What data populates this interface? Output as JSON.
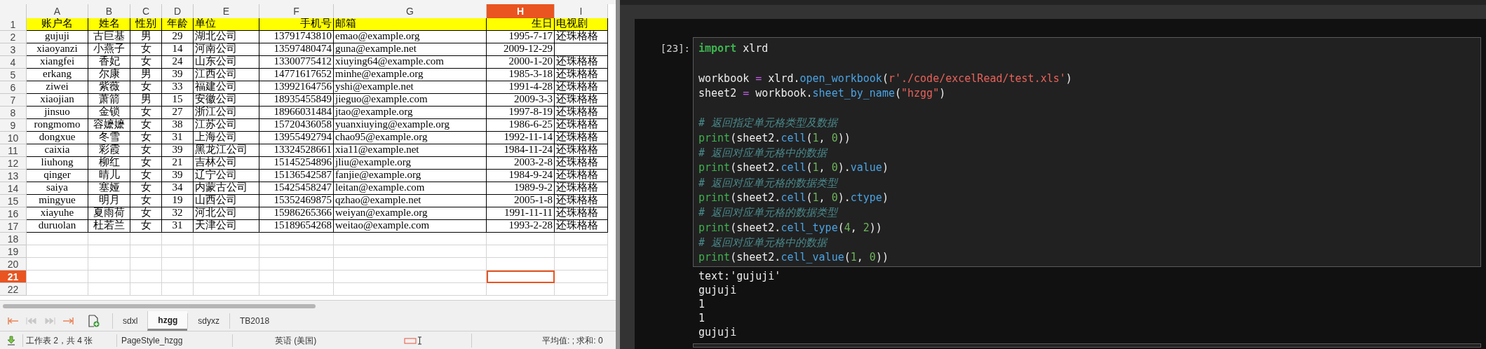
{
  "spreadsheet": {
    "column_headers": [
      {
        "label": "A",
        "selected": false
      },
      {
        "label": "B",
        "selected": false
      },
      {
        "label": "C",
        "selected": false
      },
      {
        "label": "D",
        "selected": false
      },
      {
        "label": "E",
        "selected": false
      },
      {
        "label": "F",
        "selected": false
      },
      {
        "label": "G",
        "selected": false
      },
      {
        "label": "H",
        "selected": true
      },
      {
        "label": "I",
        "selected": false
      }
    ],
    "rows": [
      {
        "number": "1",
        "selected": false,
        "cells": [
          "账户名",
          "姓名",
          "性别",
          "年龄",
          "单位",
          "手机号",
          "邮箱",
          "生日",
          "电视剧"
        ]
      },
      {
        "number": "2",
        "selected": false,
        "cells": [
          "gujuji",
          "古巨基",
          "男",
          "29",
          "湖北公司",
          "13791743810",
          "emao@example.org",
          "1995-7-17",
          "还珠格格"
        ]
      },
      {
        "number": "3",
        "selected": false,
        "cells": [
          "xiaoyanzi",
          "小燕子",
          "女",
          "14",
          "河南公司",
          "13597480474",
          "guna@example.net",
          "2009-12-29",
          null
        ]
      },
      {
        "number": "4",
        "selected": false,
        "cells": [
          "xiangfei",
          "香妃",
          "女",
          "24",
          "山东公司",
          "13300775412",
          "xiuying64@example.com",
          "2000-1-20",
          "还珠格格"
        ]
      },
      {
        "number": "5",
        "selected": false,
        "cells": [
          "erkang",
          "尔康",
          "男",
          "39",
          "江西公司",
          "14771617652",
          "minhe@example.org",
          "1985-3-18",
          "还珠格格"
        ]
      },
      {
        "number": "6",
        "selected": false,
        "cells": [
          "ziwei",
          "紫薇",
          "女",
          "33",
          "福建公司",
          "13992164756",
          "yshi@example.net",
          "1991-4-28",
          "还珠格格"
        ]
      },
      {
        "number": "7",
        "selected": false,
        "cells": [
          "xiaojian",
          "萧箭",
          "男",
          "15",
          "安徽公司",
          "18935455849",
          "jieguo@example.com",
          "2009-3-3",
          "还珠格格"
        ]
      },
      {
        "number": "8",
        "selected": false,
        "cells": [
          "jinsuo",
          "金锁",
          "女",
          "27",
          "浙江公司",
          "18966031484",
          "jtao@example.org",
          "1997-8-19",
          "还珠格格"
        ]
      },
      {
        "number": "9",
        "selected": false,
        "cells": [
          "rongmomo",
          "容嬷嬷",
          "女",
          "38",
          "江苏公司",
          "15720436058",
          "yuanxiuying@example.org",
          "1986-6-25",
          "还珠格格"
        ]
      },
      {
        "number": "10",
        "selected": false,
        "cells": [
          "dongxue",
          "冬雪",
          "女",
          "31",
          "上海公司",
          "13955492794",
          "chao95@example.org",
          "1992-11-14",
          "还珠格格"
        ]
      },
      {
        "number": "11",
        "selected": false,
        "cells": [
          "caixia",
          "彩霞",
          "女",
          "39",
          "黑龙江公司",
          "13324528661",
          "xia11@example.net",
          "1984-11-24",
          "还珠格格"
        ]
      },
      {
        "number": "12",
        "selected": false,
        "cells": [
          "liuhong",
          "柳红",
          "女",
          "21",
          "吉林公司",
          "15145254896",
          "jliu@example.org",
          "2003-2-8",
          "还珠格格"
        ]
      },
      {
        "number": "13",
        "selected": false,
        "cells": [
          "qinger",
          "晴儿",
          "女",
          "39",
          "辽宁公司",
          "15136542587",
          "fanjie@example.org",
          "1984-9-24",
          "还珠格格"
        ]
      },
      {
        "number": "14",
        "selected": false,
        "cells": [
          "saiya",
          "塞娅",
          "女",
          "34",
          "内蒙古公司",
          "15425458247",
          "leitan@example.com",
          "1989-9-2",
          "还珠格格"
        ]
      },
      {
        "number": "15",
        "selected": false,
        "cells": [
          "mingyue",
          "明月",
          "女",
          "19",
          "山西公司",
          "15352469875",
          "qzhao@example.net",
          "2005-1-8",
          "还珠格格"
        ]
      },
      {
        "number": "16",
        "selected": false,
        "cells": [
          "xiayuhe",
          "夏雨荷",
          "女",
          "32",
          "河北公司",
          "15986265366",
          "weiyan@example.org",
          "1991-11-11",
          "还珠格格"
        ]
      },
      {
        "number": "17",
        "selected": false,
        "cells": [
          "duruolan",
          "杜若兰",
          "女",
          "31",
          "天津公司",
          "15189654268",
          "weitao@example.com",
          "1993-2-28",
          "还珠格格"
        ]
      },
      {
        "number": "18",
        "selected": false,
        "cells": []
      },
      {
        "number": "19",
        "selected": false,
        "cells": []
      },
      {
        "number": "20",
        "selected": false,
        "cells": []
      },
      {
        "number": "21",
        "selected": true,
        "cells": []
      },
      {
        "number": "22",
        "selected": false,
        "cells": []
      }
    ],
    "sheet_tabs": [
      {
        "label": "sdxl",
        "selected": false
      },
      {
        "label": "hzgg",
        "selected": true
      },
      {
        "label": "sdyxz",
        "selected": false
      },
      {
        "label": "TB2018",
        "selected": false
      }
    ],
    "status_bar": {
      "sheet_info": "工作表 2，共 4 张",
      "page_style": "PageStyle_hzgg",
      "language": "英语 (美国)",
      "summary": "平均值: ; 求和: 0"
    }
  },
  "notebook": {
    "prompt": "[23]:",
    "code_lines": [
      {
        "blank_before": false,
        "tokens": [
          {
            "kind": "keyword",
            "text": "import"
          },
          {
            "kind": "name",
            "text": " xlrd"
          }
        ]
      },
      {
        "blank_before": true,
        "tokens": [
          {
            "kind": "name",
            "text": "workbook "
          },
          {
            "kind": "operator",
            "text": "="
          },
          {
            "kind": "name",
            "text": " xlrd."
          },
          {
            "kind": "attribute",
            "text": "open_workbook"
          },
          {
            "kind": "name",
            "text": "("
          },
          {
            "kind": "string",
            "text": "r'./code/excelRead/test.xls'"
          },
          {
            "kind": "name",
            "text": ")"
          }
        ]
      },
      {
        "blank_before": false,
        "tokens": [
          {
            "kind": "name",
            "text": "sheet2 "
          },
          {
            "kind": "operator",
            "text": "="
          },
          {
            "kind": "name",
            "text": " workbook."
          },
          {
            "kind": "attribute",
            "text": "sheet_by_name"
          },
          {
            "kind": "name",
            "text": "("
          },
          {
            "kind": "string",
            "text": "\"hzgg\""
          },
          {
            "kind": "name",
            "text": ")"
          }
        ]
      },
      {
        "blank_before": true,
        "tokens": [
          {
            "kind": "comment",
            "text": "# 返回指定单元格类型及数据"
          }
        ]
      },
      {
        "blank_before": false,
        "tokens": [
          {
            "kind": "builtin",
            "text": "print"
          },
          {
            "kind": "name",
            "text": "(sheet2."
          },
          {
            "kind": "attribute",
            "text": "cell"
          },
          {
            "kind": "name",
            "text": "("
          },
          {
            "kind": "number",
            "text": "1"
          },
          {
            "kind": "name",
            "text": ", "
          },
          {
            "kind": "number",
            "text": "0"
          },
          {
            "kind": "name",
            "text": "))"
          }
        ]
      },
      {
        "blank_before": false,
        "tokens": [
          {
            "kind": "comment",
            "text": "# 返回对应单元格中的数据"
          }
        ]
      },
      {
        "blank_before": false,
        "tokens": [
          {
            "kind": "builtin",
            "text": "print"
          },
          {
            "kind": "name",
            "text": "(sheet2."
          },
          {
            "kind": "attribute",
            "text": "cell"
          },
          {
            "kind": "name",
            "text": "("
          },
          {
            "kind": "number",
            "text": "1"
          },
          {
            "kind": "name",
            "text": ", "
          },
          {
            "kind": "number",
            "text": "0"
          },
          {
            "kind": "name",
            "text": ")."
          },
          {
            "kind": "attribute",
            "text": "value"
          },
          {
            "kind": "name",
            "text": ")"
          }
        ]
      },
      {
        "blank_before": false,
        "tokens": [
          {
            "kind": "comment",
            "text": "# 返回对应单元格的数据类型"
          }
        ]
      },
      {
        "blank_before": false,
        "tokens": [
          {
            "kind": "builtin",
            "text": "print"
          },
          {
            "kind": "name",
            "text": "(sheet2."
          },
          {
            "kind": "attribute",
            "text": "cell"
          },
          {
            "kind": "name",
            "text": "("
          },
          {
            "kind": "number",
            "text": "1"
          },
          {
            "kind": "name",
            "text": ", "
          },
          {
            "kind": "number",
            "text": "0"
          },
          {
            "kind": "name",
            "text": ")."
          },
          {
            "kind": "attribute",
            "text": "ctype"
          },
          {
            "kind": "name",
            "text": ")"
          }
        ]
      },
      {
        "blank_before": false,
        "tokens": [
          {
            "kind": "comment",
            "text": "# 返回对应单元格的数据类型"
          }
        ]
      },
      {
        "blank_before": false,
        "tokens": [
          {
            "kind": "builtin",
            "text": "print"
          },
          {
            "kind": "name",
            "text": "(sheet2."
          },
          {
            "kind": "attribute",
            "text": "cell_type"
          },
          {
            "kind": "name",
            "text": "("
          },
          {
            "kind": "number",
            "text": "4"
          },
          {
            "kind": "name",
            "text": ", "
          },
          {
            "kind": "number",
            "text": "2"
          },
          {
            "kind": "name",
            "text": "))"
          }
        ]
      },
      {
        "blank_before": false,
        "tokens": [
          {
            "kind": "comment",
            "text": "# 返回对应单元格中的数据"
          }
        ]
      },
      {
        "blank_before": false,
        "tokens": [
          {
            "kind": "builtin",
            "text": "print"
          },
          {
            "kind": "name",
            "text": "(sheet2."
          },
          {
            "kind": "attribute",
            "text": "cell_value"
          },
          {
            "kind": "name",
            "text": "("
          },
          {
            "kind": "number",
            "text": "1"
          },
          {
            "kind": "name",
            "text": ", "
          },
          {
            "kind": "number",
            "text": "0"
          },
          {
            "kind": "name",
            "text": "))"
          }
        ]
      }
    ],
    "output_lines": [
      "text:'gujuji'",
      "gujuji",
      "1",
      "1",
      "gujuji"
    ]
  }
}
